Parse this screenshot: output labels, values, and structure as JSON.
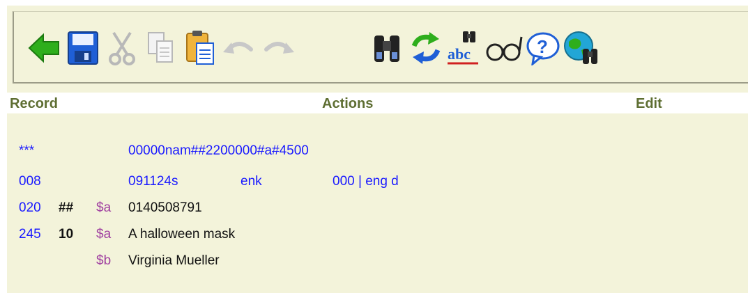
{
  "toolbar": {
    "icons": [
      "back-arrow-icon",
      "save-icon",
      "cut-icon",
      "copy-icon",
      "paste-icon",
      "undo-icon",
      "redo-icon",
      "find-icon",
      "refresh-icon",
      "spellcheck-icon",
      "preview-icon",
      "help-icon",
      "web-search-icon"
    ],
    "spell_label": "abc",
    "colors": {
      "green": "#2eae1c",
      "blue": "#1f5fd6",
      "gray": "#b8b8b8",
      "black": "#222222",
      "cyan": "#22a6d6"
    }
  },
  "menu": {
    "record": "Record",
    "actions": "Actions",
    "edit": "Edit"
  },
  "record": {
    "leader": {
      "tag": "***",
      "value": "00000nam##2200000#a#4500"
    },
    "f008": {
      "tag": "008",
      "part1": "091124s",
      "part2": "enk",
      "part3": "000 | eng d"
    },
    "f020": {
      "tag": "020",
      "ind": "##",
      "subfields": [
        {
          "code": "$a",
          "value": "0140508791"
        }
      ]
    },
    "f245": {
      "tag": "245",
      "ind": "10",
      "subfields": [
        {
          "code": "$a",
          "value": "A halloween mask"
        },
        {
          "code": "$b",
          "value": "Virginia Mueller"
        }
      ]
    }
  }
}
